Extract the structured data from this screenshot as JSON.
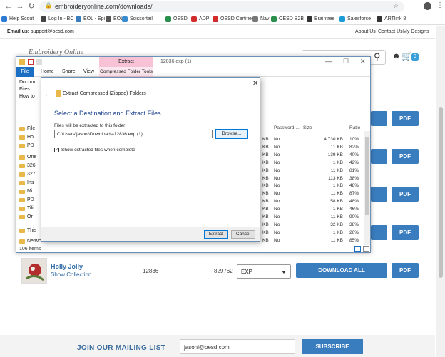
{
  "browser": {
    "url": "embroideryonline.com/downloads/",
    "bookmarks": [
      {
        "label": "Help Scout",
        "color": "#2d7ad3"
      },
      {
        "label": "Log In - BC",
        "color": "#444444"
      },
      {
        "label": "EOL - Epi",
        "color": "#3a7dbf"
      },
      {
        "label": "EOL",
        "color": "#555555"
      },
      {
        "label": "Scissortail",
        "color": "#3b8ccf"
      },
      {
        "label": "OESD",
        "color": "#2a8f4c"
      },
      {
        "label": "ADP",
        "color": "#d12b2b"
      },
      {
        "label": "OESD Certified",
        "color": "#d12b2b"
      },
      {
        "label": "Nav",
        "color": "#777777"
      },
      {
        "label": "OESD B2B",
        "color": "#2a8f4c"
      },
      {
        "label": "Braintree",
        "color": "#333333"
      },
      {
        "label": "Salesforce",
        "color": "#1d9bd7"
      },
      {
        "label": "ARTlink 8",
        "color": "#333333"
      }
    ]
  },
  "site": {
    "email_label": "Email us:",
    "email": "support@oesd.com",
    "links": [
      "About Us",
      "Contact Us",
      "My Designs"
    ],
    "logo_fragment": "Embroidery Online",
    "cart_count": "0",
    "download_label": "DOWNLOAD ALL",
    "pdf_label": "PDF",
    "product": {
      "name": "Holly Jolly",
      "show_collection": "Show Collection",
      "number": "12836",
      "id": "829762",
      "format": "EXP"
    },
    "mailing": {
      "title": "JOIN OUR MAILING LIST",
      "input_value": "jasonl@oesd.com",
      "subscribe": "SUBSCRIBE"
    }
  },
  "explorer": {
    "extract_tab": "Extract",
    "title": "12836.exp (1)",
    "ribbon": {
      "file": "File",
      "home": "Home",
      "share": "Share",
      "view": "View",
      "cft": "Compressed Folder Tools"
    },
    "nav_items": [
      "Docum",
      "Files",
      "How to",
      "File",
      "Ho",
      "PD",
      "One",
      "326",
      "327",
      "Ins",
      "Mi",
      "PD",
      "Tili",
      "Or",
      "This",
      "Network"
    ],
    "columns": {
      "password": "Password ...",
      "size": "Size",
      "ratio": "Ratio"
    },
    "rows": [
      {
        "kb": "KB",
        "pw": "No",
        "size": "4,730 KB",
        "ratio": "10%"
      },
      {
        "kb": "KB",
        "pw": "No",
        "size": "11 KB",
        "ratio": "82%"
      },
      {
        "kb": "KB",
        "pw": "No",
        "size": "139 KB",
        "ratio": "40%"
      },
      {
        "kb": "KB",
        "pw": "No",
        "size": "1 KB",
        "ratio": "42%"
      },
      {
        "kb": "KB",
        "pw": "No",
        "size": "11 KB",
        "ratio": "81%"
      },
      {
        "kb": "KB",
        "pw": "No",
        "size": "113 KB",
        "ratio": "38%"
      },
      {
        "kb": "KB",
        "pw": "No",
        "size": "1 KB",
        "ratio": "48%"
      },
      {
        "kb": "KB",
        "pw": "No",
        "size": "11 KB",
        "ratio": "87%"
      },
      {
        "kb": "KB",
        "pw": "No",
        "size": "58 KB",
        "ratio": "48%"
      },
      {
        "kb": "KB",
        "pw": "No",
        "size": "1 KB",
        "ratio": "46%"
      },
      {
        "kb": "KB",
        "pw": "No",
        "size": "11 KB",
        "ratio": "90%"
      },
      {
        "kb": "KB",
        "pw": "No",
        "size": "32 KB",
        "ratio": "38%"
      },
      {
        "kb": "KB",
        "pw": "No",
        "size": "1 KB",
        "ratio": "26%"
      },
      {
        "kb": "KB",
        "pw": "No",
        "size": "11 KB",
        "ratio": "85%"
      }
    ],
    "status": "106 items"
  },
  "dialog": {
    "header": "Extract Compressed (Zipped) Folders",
    "subtitle": "Select a Destination and Extract Files",
    "dest_label": "Files will be extracted to this folder:",
    "path": "C:\\Users\\jasonl\\Downloads\\12836.exp (1)",
    "browse": "Browse...",
    "checkbox_label": "Show extracted files when complete",
    "extract": "Extract",
    "cancel": "Cancel"
  }
}
